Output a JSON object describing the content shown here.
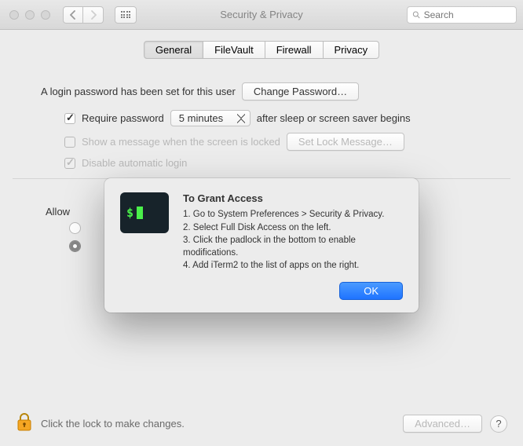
{
  "window": {
    "title": "Security & Privacy",
    "search_placeholder": "Search"
  },
  "tabs": [
    {
      "label": "General",
      "selected": true
    },
    {
      "label": "FileVault",
      "selected": false
    },
    {
      "label": "Firewall",
      "selected": false
    },
    {
      "label": "Privacy",
      "selected": false
    }
  ],
  "general": {
    "login_password_text": "A login password has been set for this user",
    "change_password_label": "Change Password…",
    "require_password_label": "Require password",
    "require_password_checked": true,
    "delay_value": "5 minutes",
    "after_sleep_text": "after sleep or screen saver begins",
    "show_message_label": "Show a message when the screen is locked",
    "show_message_checked": false,
    "set_lock_message_label": "Set Lock Message…",
    "disable_auto_login_label": "Disable automatic login",
    "disable_auto_login_checked": true,
    "allow_label": "Allow"
  },
  "footer": {
    "lock_text": "Click the lock to make changes.",
    "advanced_label": "Advanced…",
    "help_symbol": "?"
  },
  "dialog": {
    "icon_glyph": "$",
    "title": "To Grant Access",
    "steps": [
      "1. Go to System Preferences > Security & Privacy.",
      "2. Select Full Disk Access on the left.",
      "3. Click the padlock in the bottom to enable modifications.",
      "4. Add iTerm2 to the list of apps on the right."
    ],
    "ok_label": "OK"
  }
}
